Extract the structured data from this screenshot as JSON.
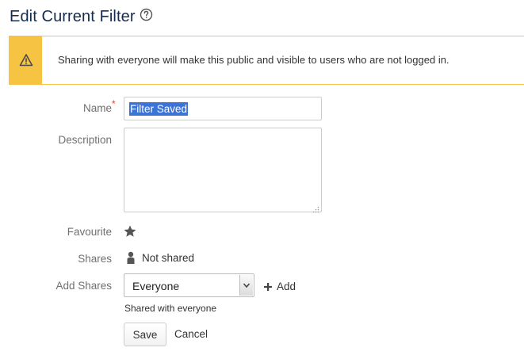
{
  "page": {
    "title": "Edit Current Filter",
    "help_icon": "help-circle-icon"
  },
  "banner": {
    "icon": "warning-icon",
    "message": "Sharing with everyone will make this public and visible to users who are not logged in.",
    "accent_color": "#f6c342"
  },
  "form": {
    "name": {
      "label": "Name",
      "required_marker": "*",
      "value": "Filter Saved"
    },
    "description": {
      "label": "Description",
      "value": ""
    },
    "favourite": {
      "label": "Favourite",
      "icon": "star-icon"
    },
    "shares": {
      "label": "Shares",
      "icon": "person-icon",
      "value": "Not shared"
    },
    "add_shares": {
      "label": "Add Shares",
      "selected": "Everyone",
      "add_label": "Add",
      "add_icon": "plus-icon",
      "help_text": "Shared with everyone"
    }
  },
  "actions": {
    "save_label": "Save",
    "cancel_label": "Cancel"
  }
}
